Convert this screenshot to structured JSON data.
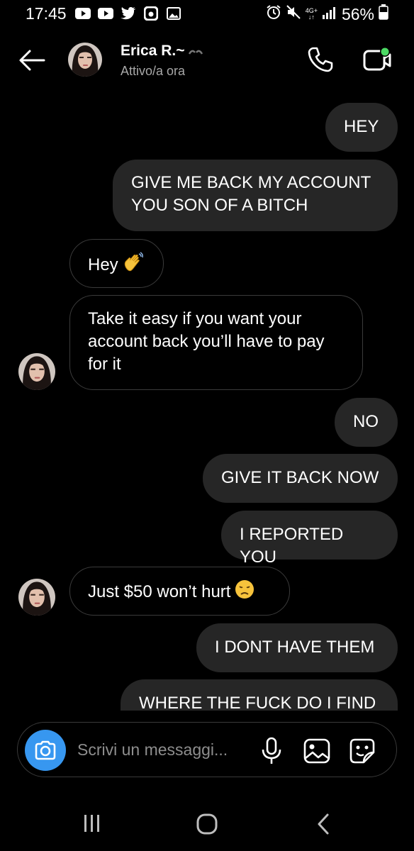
{
  "status_bar": {
    "time": "17:45",
    "left_icons": [
      "youtube-icon",
      "youtube-icon",
      "twitter-icon",
      "instagram-icon",
      "gallery-icon"
    ],
    "network_label_top": "4G+",
    "battery": "56%"
  },
  "header": {
    "contact_name": "Erica R.~",
    "contact_status": "Attivo/a ora"
  },
  "messages": [
    {
      "id": "m1",
      "dir": "out",
      "text": "HEY"
    },
    {
      "id": "m2",
      "dir": "out",
      "text": "GIVE ME BACK MY ACCOUNT YOU SON OF A BITCH"
    },
    {
      "id": "m3",
      "dir": "in",
      "text": "Hey",
      "emoji": "waving-hand"
    },
    {
      "id": "m4",
      "dir": "in",
      "text": "Take it easy if you want your account back you’ll have to pay for it"
    },
    {
      "id": "m5",
      "dir": "out",
      "text": "NO"
    },
    {
      "id": "m6",
      "dir": "out",
      "text": "GIVE IT BACK NOW"
    },
    {
      "id": "m7",
      "dir": "out",
      "text": "I REPORTED YOU"
    },
    {
      "id": "m8",
      "dir": "in",
      "text": "Just $50 won’t hurt",
      "emoji": "disappointed-face"
    },
    {
      "id": "m9",
      "dir": "out",
      "text": "I DONT HAVE THEM"
    },
    {
      "id": "m10",
      "dir": "out",
      "text": "WHERE THE FUCK DO I FIND"
    }
  ],
  "composer": {
    "placeholder": "Scrivi un messaggi..."
  },
  "colors": {
    "background": "#000000",
    "outgoing_bubble": "#262626",
    "incoming_border": "#3b3b3b",
    "camera_button": "#3797f0",
    "secondary_text": "#a8a8a8",
    "online_dot": "#4cd964"
  }
}
